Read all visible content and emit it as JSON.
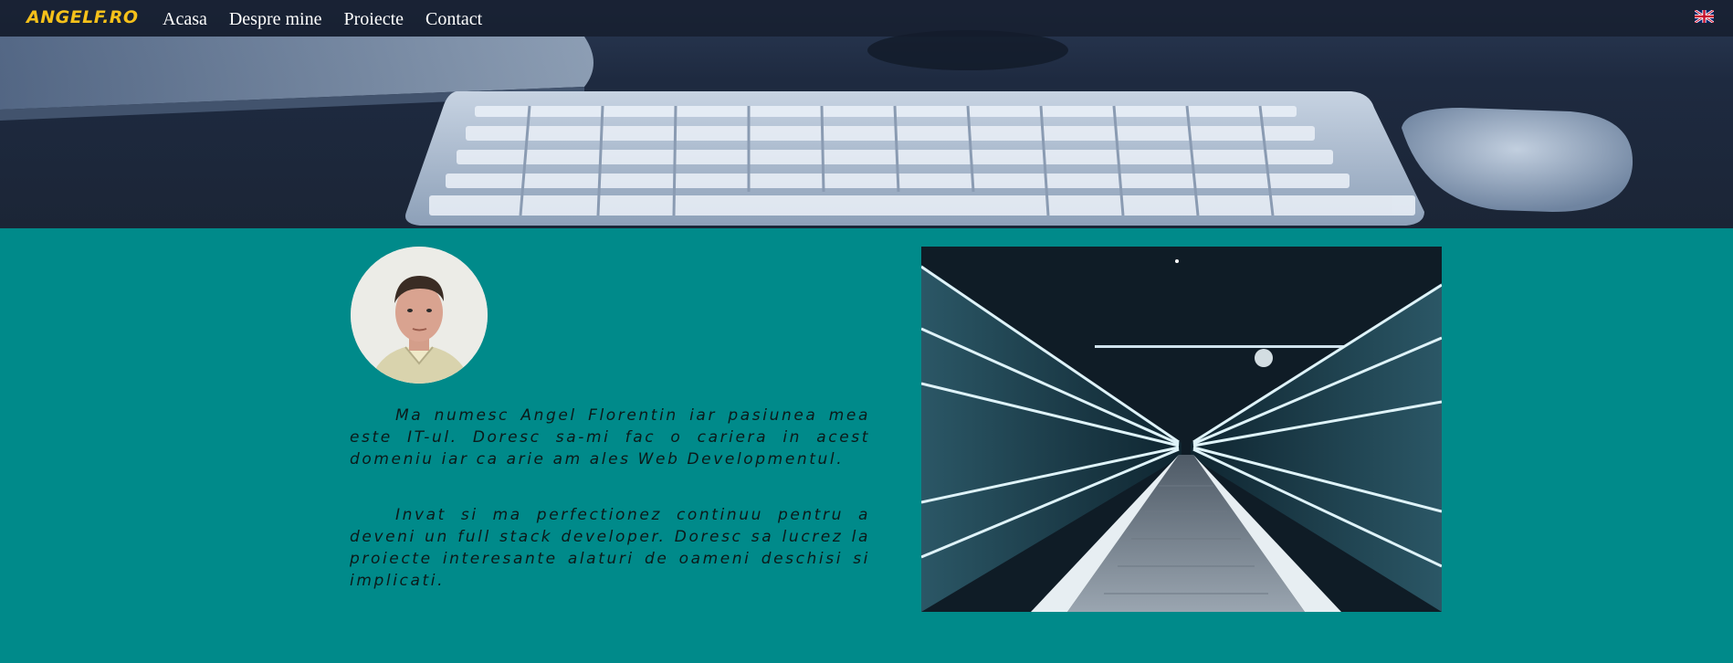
{
  "brand": "ANGELF.RO",
  "nav": [
    {
      "label": "Acasa"
    },
    {
      "label": "Despre mine"
    },
    {
      "label": "Proiecte"
    },
    {
      "label": "Contact"
    }
  ],
  "language_icon": "uk-flag-icon",
  "hero_image": "keyboard-mouse-desk-photo",
  "profile_image": "profile-photo",
  "bio": {
    "paragraph1": "Ma numesc Angel Florentin iar pasiunea mea este IT-ul. Doresc sa-mi fac o cariera in acest domeniu iar ca arie am ales Web Developmentul.",
    "paragraph2": "Invat si ma perfectionez continuu pentru a deveni un full stack developer. Doresc sa lucrez la proiecte interesante alaturi de oameni deschisi si implicati."
  },
  "feature_image": "moving-walkway-light-trails-photo",
  "colors": {
    "background": "#008a8a",
    "brand": "#f5c11a",
    "nav_text": "#ffffff",
    "navbar": "#141c2c"
  }
}
